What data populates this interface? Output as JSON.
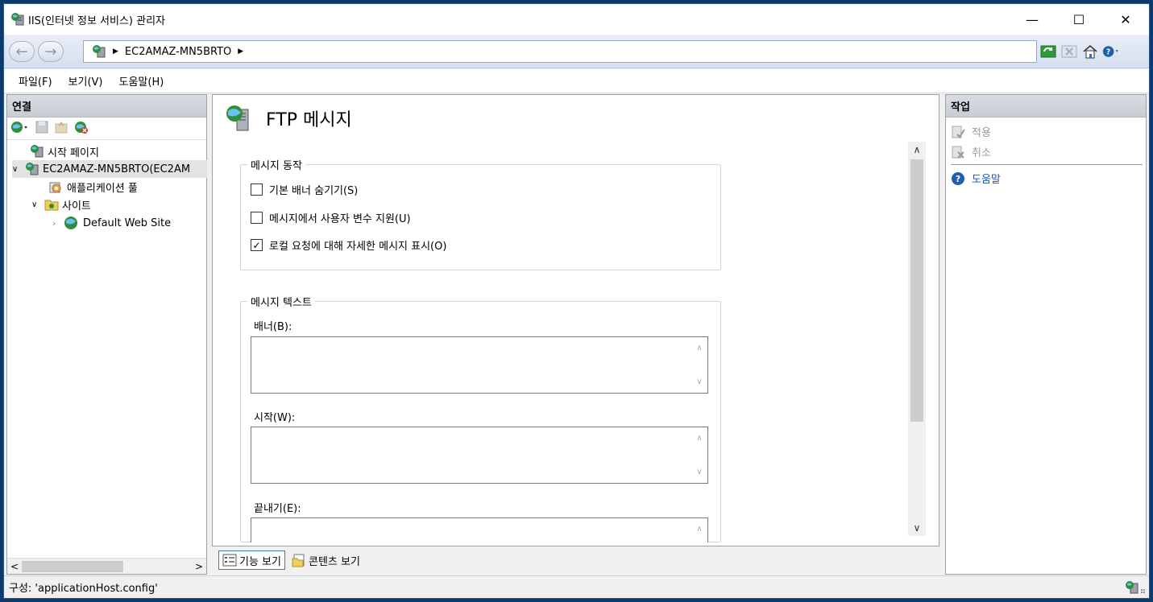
{
  "window": {
    "title": "IIS(인터넷 정보 서비스) 관리자",
    "minimize": "—",
    "maximize": "☐",
    "close": "✕"
  },
  "nav": {
    "back": "←",
    "forward": "→",
    "crumbs": [
      "EC2AMAZ-MN5BRTO"
    ]
  },
  "menu": {
    "file": "파일(F)",
    "view": "보기(V)",
    "help": "도움말(H)"
  },
  "connections": {
    "header": "연결",
    "tree": {
      "start_page": "시작 페이지",
      "server": "EC2AMAZ-MN5BRTO(EC2AM",
      "app_pools": "애플리케이션 풀",
      "sites": "사이트",
      "default_site": "Default Web Site"
    },
    "scroll_left": "<",
    "scroll_right": ">"
  },
  "feature": {
    "title": "FTP 메시지",
    "behavior_group": "메시지 동작",
    "checks": [
      {
        "label": "기본 배너 숨기기(S)",
        "checked": false
      },
      {
        "label": "메시지에서 사용자 변수 지원(U)",
        "checked": false
      },
      {
        "label": "로컬 요청에 대해 자세한 메시지 표시(O)",
        "checked": true
      }
    ],
    "text_group": "메시지 텍스트",
    "fields": {
      "banner": "배너(B):",
      "welcome": "시작(W):",
      "exit": "끝내기(E):"
    }
  },
  "view_tabs": {
    "features": "기능 보기",
    "content": "콘텐츠 보기"
  },
  "actions": {
    "header": "작업",
    "apply": "적용",
    "cancel": "취소",
    "help": "도움말"
  },
  "status": {
    "text": "구성: 'applicationHost.config'"
  }
}
